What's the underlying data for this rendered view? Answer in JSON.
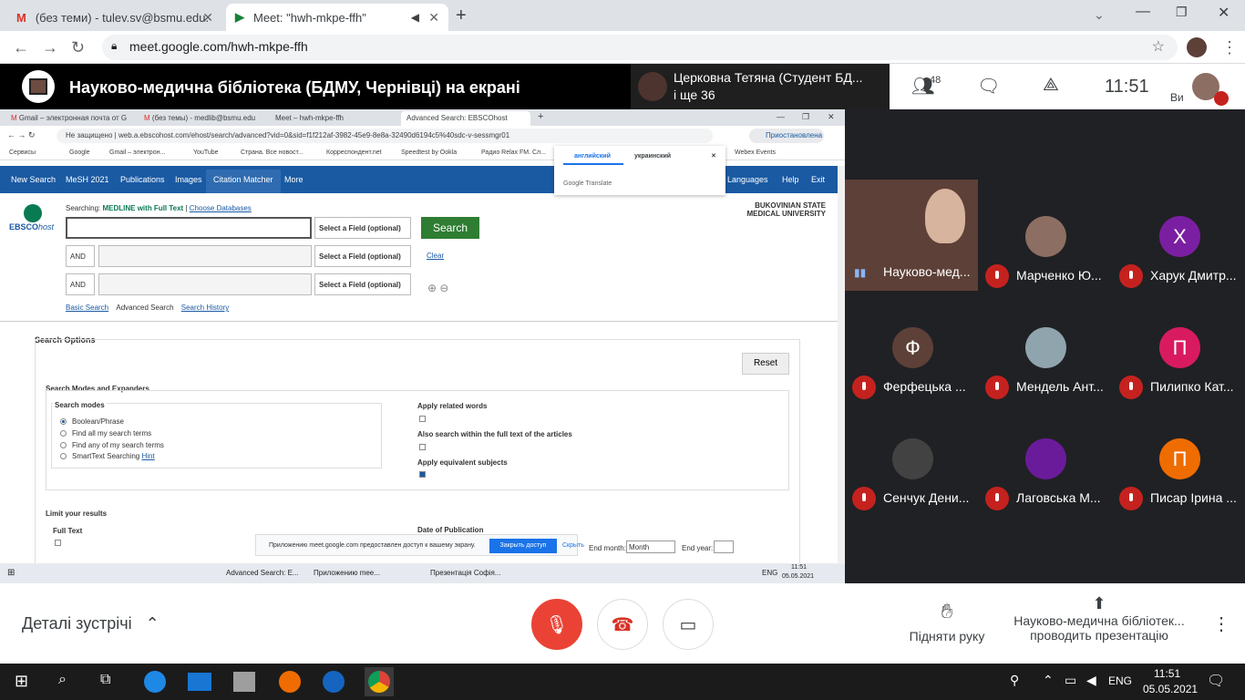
{
  "browser": {
    "tabs": [
      {
        "label": "(без теми) - tulev.sv@bsmu.edu.",
        "icon": "gmail-icon"
      },
      {
        "label": "Meet: \"hwh-mkpe-ffh\"",
        "icon": "meet-icon"
      }
    ],
    "url": "meet.google.com/hwh-mkpe-ffh"
  },
  "meet": {
    "presenting_title": "Науково-медична бібліотека (БДМУ, Чернівці) на екрані",
    "featured_participant": "Церковна Тетяна (Студент БД...",
    "others_count": "і ще 36",
    "participants_count": "48",
    "time": "11:51",
    "you_label": "Ви",
    "meeting_details": "Деталі зустрічі",
    "raise_hand": "Підняти руку",
    "presenter_line1": "Науково-медична бібліотек...",
    "presenter_line2": "проводить презентацію"
  },
  "participants": [
    {
      "name": "Науково-мед...",
      "initial": "",
      "color": "#6d4c41",
      "muted": false
    },
    {
      "name": "Марченко Ю...",
      "initial": "",
      "color": "#8d6e63",
      "muted": true
    },
    {
      "name": "Харук Дмитр...",
      "initial": "Х",
      "color": "#7b1fa2",
      "muted": true
    },
    {
      "name": "Ферфецька ...",
      "initial": "Ф",
      "color": "#5d4037",
      "muted": true
    },
    {
      "name": "Мендель Ант...",
      "initial": "",
      "color": "#90a4ae",
      "muted": true
    },
    {
      "name": "Пилипко Кат...",
      "initial": "П",
      "color": "#d81b60",
      "muted": true
    },
    {
      "name": "Сенчук Дени...",
      "initial": "",
      "color": "#424242",
      "muted": true
    },
    {
      "name": "Лаговська М...",
      "initial": "",
      "color": "#6a1b9a",
      "muted": true
    },
    {
      "name": "Писар Ірина ...",
      "initial": "П",
      "color": "#ef6c00",
      "muted": true
    }
  ],
  "shared": {
    "tabs": [
      "Gmail – электронная почта от G",
      "(без темы) - medlib@bsmu.edu",
      "Meet – hwh-mkpe-ffh",
      "Advanced Search: EBSCOhost"
    ],
    "not_secure": "Не защищено",
    "url": "web.a.ebscohost.com/ehost/search/advanced?vid=0&sid=f1f212af-3982-45e9-8e8a-32490d6194c5%40sdc-v-sessmgr01",
    "paused": "Приостановлена",
    "bookmarks": [
      "Сервисы",
      "Google",
      "Gmail – электрон...",
      "YouTube",
      "Страна. Все новост...",
      "Корреспондент.net",
      "Speedtest by Ookla",
      "Радио Relax FM. Сл...",
      "Webex Events"
    ],
    "translate": {
      "lang1": "английский",
      "lang2": "украинский",
      "brand": "Google Translate"
    },
    "nav": [
      "New Search",
      "MeSH 2021",
      "Publications",
      "Images",
      "Citation Matcher",
      "More",
      "Languages",
      "Help",
      "Exit"
    ],
    "searching_label": "Searching:",
    "database": "MEDLINE with Full Text",
    "choose_db": "Choose Databases",
    "institution1": "BUKOVINIAN STATE",
    "institution2": "MEDICAL UNIVERSITY",
    "select_field": "Select a Field (optional)",
    "and_label": "AND",
    "search_btn": "Search",
    "clear": "Clear",
    "basic_search": "Basic Search",
    "advanced_search": "Advanced Search",
    "search_history": "Search History",
    "search_options": "Search Options",
    "reset": "Reset",
    "modes_expanders": "Search Modes and Expanders",
    "search_modes": "Search modes",
    "modes": [
      "Boolean/Phrase",
      "Find all my search terms",
      "Find any of my search terms",
      "SmartText Searching"
    ],
    "hint": "Hint",
    "apply_related": "Apply related words",
    "also_search": "Also search within the full text of the articles",
    "apply_equiv": "Apply equivalent subjects",
    "limit": "Limit your results",
    "full_text": "Full Text",
    "date_pub": "Date of Publication",
    "end_month": "End month:",
    "month": "Month",
    "end_year": "End year:",
    "share_msg": "Приложению meet.google.com предоставлен доступ к вашему экрану.",
    "close_access": "Закрыть доступ",
    "hide": "Скрыть",
    "taskbar": [
      "Advanced Search: E...",
      "Приложению mee...",
      "Презентація Софія..."
    ],
    "lang": "ENG",
    "time": "11:51",
    "date": "05.05.2021"
  },
  "windows": {
    "lang": "ENG",
    "time": "11:51",
    "date": "05.05.2021"
  }
}
